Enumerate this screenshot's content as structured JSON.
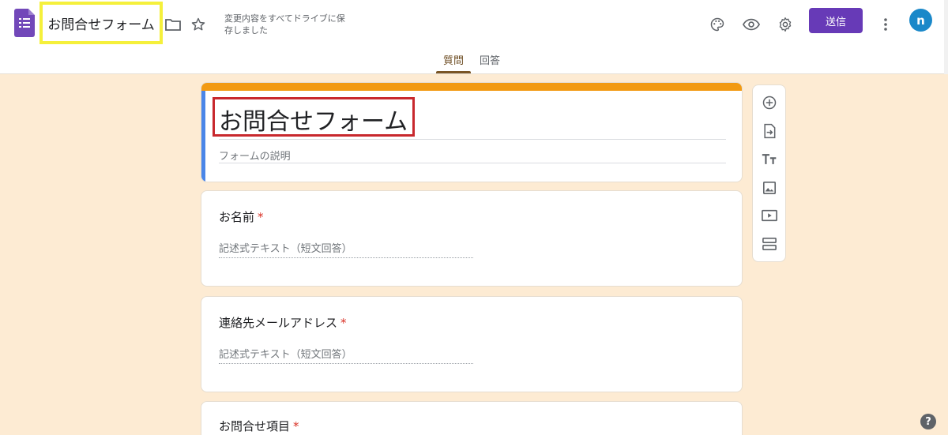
{
  "header": {
    "doc_title": "お問合せフォーム",
    "save_status": "変更内容をすべてドライブに保存しました",
    "send_label": "送信",
    "avatar_initial": "n",
    "icons": [
      "forms-logo-icon",
      "folder-icon",
      "star-icon",
      "palette-icon",
      "eye-icon",
      "gear-icon",
      "more-vert-icon",
      "help-icon"
    ]
  },
  "tabs": [
    {
      "label": "質問",
      "active": true
    },
    {
      "label": "回答",
      "active": false
    }
  ],
  "form": {
    "title": "お問合せフォーム",
    "description_placeholder": "フォームの説明",
    "questions": [
      {
        "title": "お名前",
        "required_mark": "*",
        "hint": "記述式テキスト（短文回答）"
      },
      {
        "title": "連絡先メールアドレス",
        "required_mark": "*",
        "hint": "記述式テキスト（短文回答）"
      },
      {
        "title": "お問合せ項目",
        "required_mark": "*"
      }
    ]
  },
  "toolbar": {
    "items": [
      "add-question-icon",
      "import-questions-icon",
      "add-title-icon",
      "add-image-icon",
      "add-video-icon",
      "add-section-icon"
    ]
  },
  "help_label": "?",
  "colors": {
    "accent_purple": "#673ab7",
    "theme_orange": "#f29a12",
    "background": "#fdebd3",
    "highlight_yellow": "#f5f03b",
    "highlight_red": "#c8282d"
  }
}
